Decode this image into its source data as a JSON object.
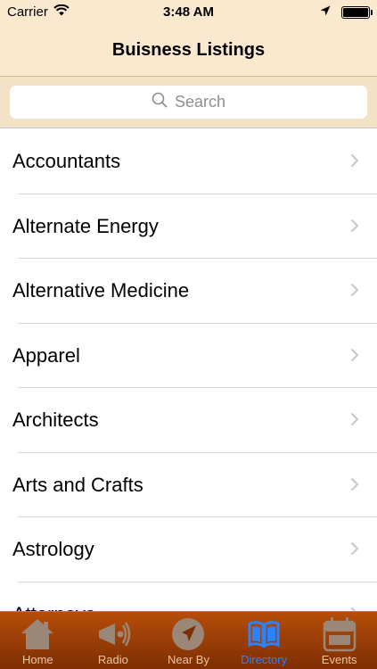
{
  "status_bar": {
    "carrier": "Carrier",
    "time": "3:48 AM",
    "battery_level": 1.0
  },
  "nav": {
    "title": "Buisness Listings"
  },
  "search": {
    "placeholder": "Search"
  },
  "list": {
    "items": [
      {
        "label": "Accountants"
      },
      {
        "label": "Alternate Energy"
      },
      {
        "label": "Alternative Medicine"
      },
      {
        "label": "Apparel"
      },
      {
        "label": "Architects"
      },
      {
        "label": "Arts and Crafts"
      },
      {
        "label": "Astrology"
      },
      {
        "label": "Attorneys"
      }
    ]
  },
  "tabs": [
    {
      "label": "Home",
      "icon": "home-icon"
    },
    {
      "label": "Radio",
      "icon": "radio-icon"
    },
    {
      "label": "Near By",
      "icon": "compass-icon"
    },
    {
      "label": "Directory",
      "icon": "book-icon",
      "active": true
    },
    {
      "label": "Events",
      "icon": "events-calendar-icon"
    }
  ],
  "colors": {
    "header_bg": "#fbe9cf",
    "search_bg": "#f4e2c6",
    "tab_bar_bg": "#9a3c06",
    "tab_active": "#2a82ff",
    "tab_inactive": "#e8c6a5"
  }
}
